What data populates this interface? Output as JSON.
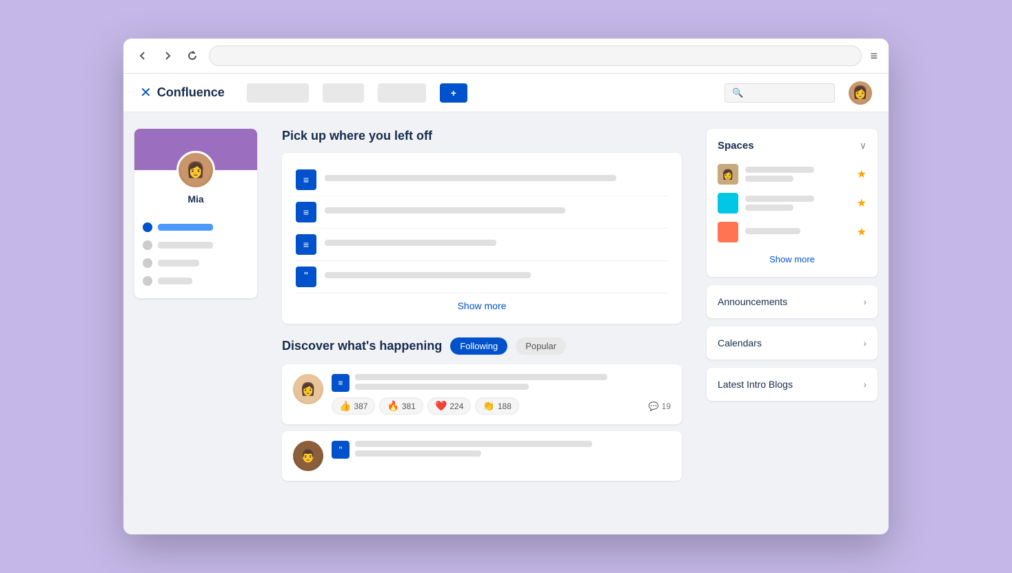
{
  "browser": {
    "url_placeholder": ""
  },
  "header": {
    "logo_text": "Confluence",
    "create_label": "+ ",
    "search_placeholder": ""
  },
  "profile": {
    "name": "Mia"
  },
  "recent": {
    "section_title": "Pick up where you left off",
    "show_more": "Show more"
  },
  "discover": {
    "section_title": "Discover what's happening",
    "tab_following": "Following",
    "tab_popular": "Popular",
    "post1": {
      "reactions": [
        {
          "emoji": "👍",
          "count": "387"
        },
        {
          "emoji": "🔥",
          "count": "381"
        },
        {
          "emoji": "❤️",
          "count": "224"
        },
        {
          "emoji": "👏",
          "count": "188"
        }
      ],
      "comments": "19"
    }
  },
  "spaces": {
    "title": "Spaces",
    "show_more": "Show more"
  },
  "announcements": {
    "title": "Announcements"
  },
  "calendars": {
    "title": "Calendars"
  },
  "latest_intro_blogs": {
    "title": "Latest Intro Blogs"
  }
}
